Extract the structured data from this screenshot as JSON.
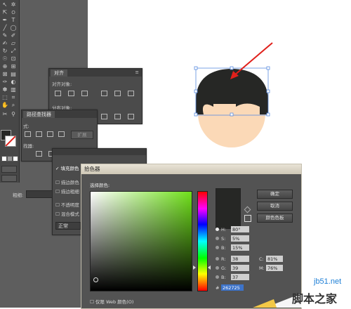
{
  "align_panel": {
    "tab": "对齐",
    "align_objects_label": "对齐对象:",
    "distribute_objects_label": "分布对象:"
  },
  "pathfinder_panel": {
    "tab": "路径查找器",
    "shape_modes_label": "式:",
    "pathfinders_label": "找器:",
    "expand_label": "扩展"
  },
  "appearance_panel": {
    "fill_color": "填充颜色",
    "stroke_color": "描边颜色",
    "stroke_weight": "描边粗细",
    "opacity": "不透明度",
    "blend_mode": "混合模式",
    "normal": "正常",
    "weight_label": "粗细:"
  },
  "color_picker": {
    "title": "拾色器",
    "select_color_label": "选择颜色:",
    "ok": "确定",
    "cancel": "取消",
    "swatches": "颜色色板",
    "web_only_label": "仅限 Web 颜色(O)",
    "current_color": "#262725",
    "hue_label": "H:",
    "hue_value": "80°",
    "sat_label": "S:",
    "sat_value": "5%",
    "bri_label": "B:",
    "bri_value": "15%",
    "r_label": "R:",
    "r_value": "38",
    "g_label": "G:",
    "g_value": "39",
    "b_label": "B:",
    "b_value": "37",
    "c_label": "C:",
    "c_value": "81%",
    "m_label": "M:",
    "m_value": "76%",
    "hex_label": "#",
    "hex_value": "262725"
  },
  "canvas": {
    "hair_color": "#262725",
    "face_color": "#fbd9b7",
    "arrow_color": "#e0201b"
  },
  "watermark": {
    "site": "jb51.net",
    "brand": "脚本之家"
  }
}
